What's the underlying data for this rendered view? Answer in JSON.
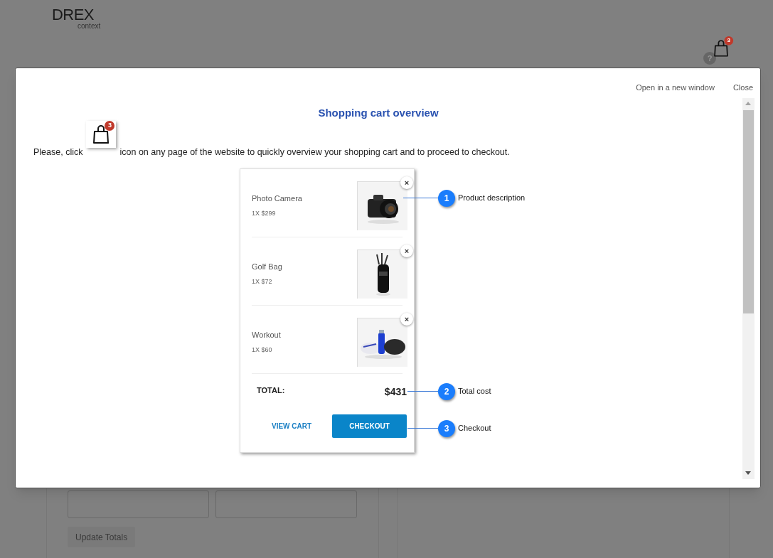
{
  "page": {
    "logo": {
      "name": "DREX",
      "tagline": "context"
    },
    "cart_badge": "3",
    "help": "?",
    "update_button": "Update Totals"
  },
  "modal": {
    "links": [
      "Open in a new window",
      "Close"
    ],
    "title": "Shopping cart overview",
    "intro_before": "Please, click",
    "intro_icon_badge": "3",
    "intro_after": "icon on any page of the website to quickly overview your shopping cart and to proceed to checkout.",
    "cart": {
      "items": [
        {
          "name": "Photo Camera",
          "price": "1X $299",
          "remove": "×"
        },
        {
          "name": "Golf Bag",
          "price": "1X $72",
          "remove": "×"
        },
        {
          "name": "Workout",
          "price": "1X $60",
          "remove": "×"
        }
      ],
      "total_label": "TOTAL:",
      "total": "$431",
      "view_cart": "VIEW CART",
      "checkout": "CHECKOUT"
    },
    "callouts": [
      {
        "number": "1",
        "label": "Product description"
      },
      {
        "number": "2",
        "label": "Total cost"
      },
      {
        "number": "3",
        "label": "Checkout"
      }
    ]
  }
}
